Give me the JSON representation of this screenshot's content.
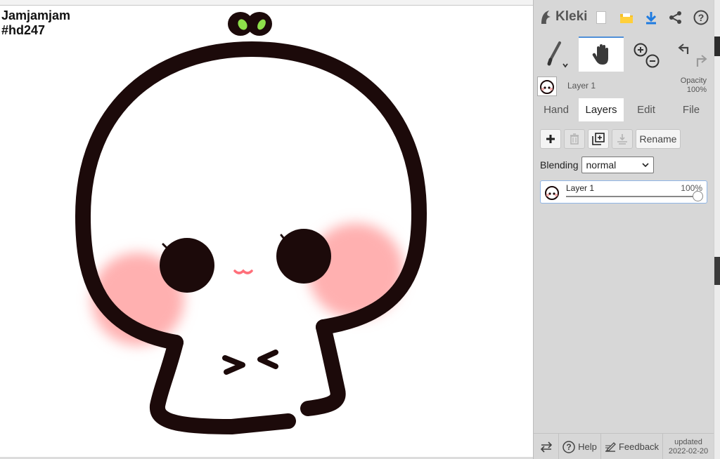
{
  "canvas": {
    "overlay_line1": "Jamjamjam",
    "overlay_line2": "#hd247"
  },
  "topbar": {
    "app_name": "Kleki",
    "icons": [
      "new-image-icon",
      "open-folder-icon",
      "download-icon",
      "share-icon",
      "help-circle-icon"
    ],
    "download_color": "#1e7be0"
  },
  "tools": {
    "active": "hand",
    "items": [
      "brush",
      "hand",
      "zoom",
      "undo-redo"
    ]
  },
  "layer_info": {
    "name": "Layer 1",
    "opacity_label": "Opacity",
    "opacity_value": "100%"
  },
  "tabs": {
    "items": [
      "Hand",
      "Layers",
      "Edit",
      "File"
    ],
    "active": "Layers"
  },
  "layers_panel": {
    "rename_label": "Rename",
    "blending_label": "Blending",
    "blending_value": "normal",
    "layer": {
      "name": "Layer 1",
      "opacity": "100%",
      "opacity_fraction": 1.0
    }
  },
  "footer": {
    "help_label": "Help",
    "feedback_label": "Feedback",
    "updated_label": "updated",
    "updated_date": "2022-02-20"
  },
  "colors": {
    "panel_bg": "#d7d7d7",
    "accent_blue": "#4f8fd8",
    "stroke": "#1c0a0a",
    "blush": "#ffb3b3",
    "sprout": "#8ee04a"
  }
}
